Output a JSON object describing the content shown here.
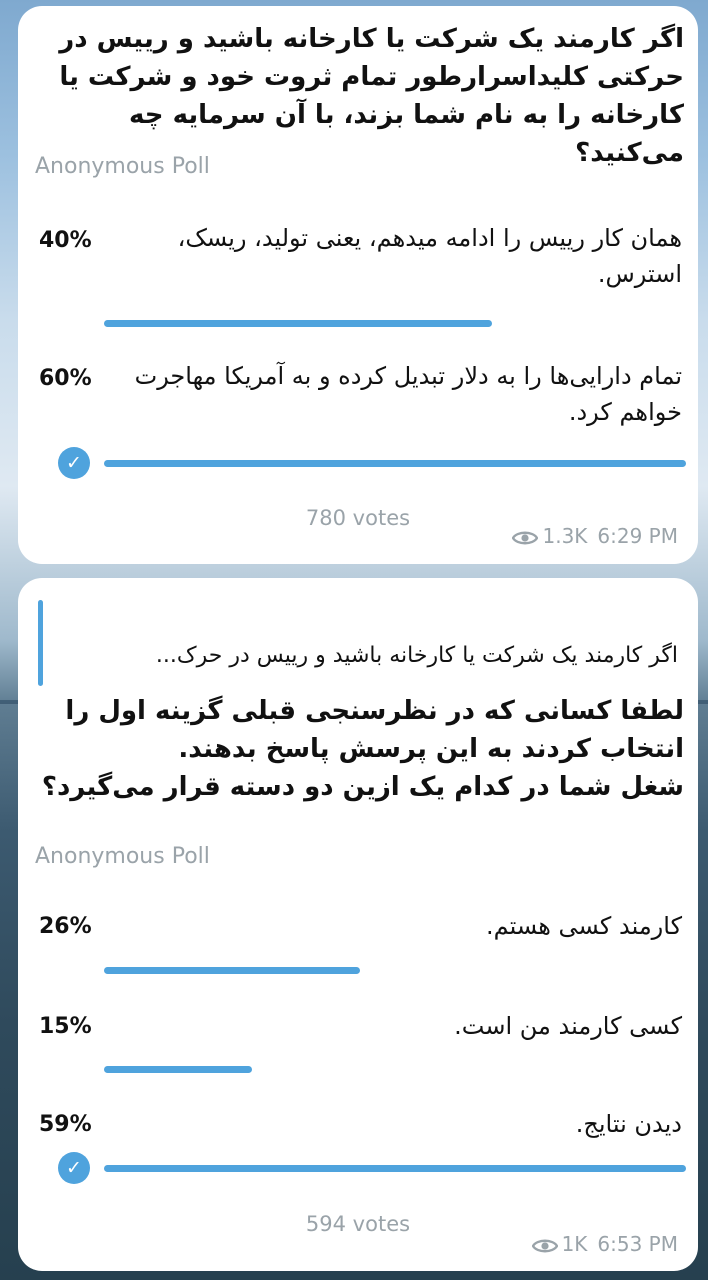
{
  "messages": [
    {
      "question": "اگر کارمند یک شرکت یا کارخانه باشید و رییس در حرکتی کلیداسرارطور تمام ثروت خود و شرکت یا کارخانه را به نام شما بزند، با آن سرمایه چه می‌کنید؟",
      "poll_type": "Anonymous Poll",
      "options": [
        {
          "percent": "40%",
          "text": "همان کار رییس را ادامه میدهم، یعنی تولید، ریسک، استرس.",
          "fraction": 0.4,
          "chosen": false
        },
        {
          "percent": "60%",
          "text": "تمام دارایی‌ها را به دلار تبدیل کرده و به آمریکا مهاجرت خواهم کرد.",
          "fraction": 0.6,
          "chosen": true
        }
      ],
      "votes": "780 votes",
      "views": "1.3K",
      "time": "6:29 PM"
    },
    {
      "reply_to": "اگر کارمند یک شرکت یا کارخانه باشید و رییس در حرک...",
      "question": "لطفا کسانی که در نظرسنجی قبلی گزینه اول را انتخاب کردند به این پرسش پاسخ بدهند.\nشغل شما در کدام یک ازین دو دسته قرار می‌گیرد؟",
      "poll_type": "Anonymous Poll",
      "options": [
        {
          "percent": "26%",
          "text": "کارمند کسی هستم.",
          "fraction": 0.26,
          "chosen": false
        },
        {
          "percent": "15%",
          "text": "کسی کارمند من است.",
          "fraction": 0.15,
          "chosen": false
        },
        {
          "percent": "59%",
          "text": "دیدن نتایج.",
          "fraction": 0.59,
          "chosen": true
        }
      ],
      "votes": "594 votes",
      "views": "1K",
      "time": "6:53 PM"
    }
  ],
  "colors": {
    "accent": "#4fa3dd",
    "muted": "#9aa3a9",
    "card": "#ffffff"
  },
  "icons": {
    "check": "checkmark-icon",
    "views": "eye-icon"
  }
}
